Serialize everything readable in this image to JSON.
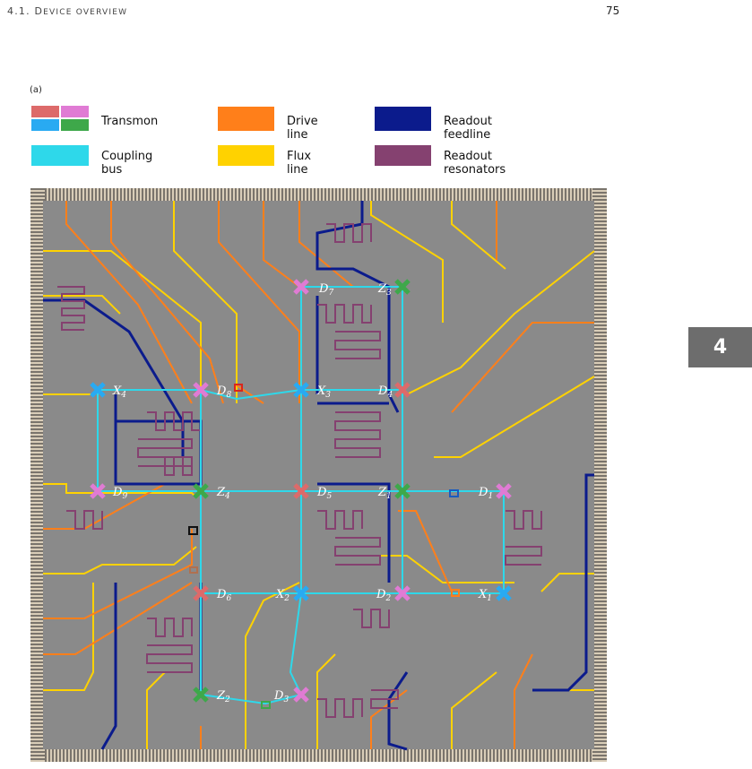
{
  "header": {
    "section_prefix": "4.1. ",
    "section_cap1": "D",
    "section_rest1": "EVICE ",
    "section_rest2": "OVERVIEW",
    "page_number": "75"
  },
  "figure": {
    "panel_label": "(a)"
  },
  "legend": {
    "transmon": "Transmon",
    "coupling_bus": "Coupling bus",
    "drive_line": "Drive line",
    "flux_line": "Flux line",
    "readout_feedline": "Readout feedline",
    "readout_resonators": "Readout resonators"
  },
  "colors": {
    "transmon_red": "#dd6a6a",
    "transmon_pink": "#e07bd4",
    "transmon_blue": "#29aaf2",
    "transmon_green": "#3ea84a",
    "coupling_bus": "#2ed8ea",
    "drive_line": "#ff7f1a",
    "flux_line": "#ffd200",
    "readout_feedline": "#0b1b8c",
    "readout_resonators": "#854170",
    "chip_bg": "#8a8a8a"
  },
  "qubits": {
    "D7": {
      "n": "D",
      "s": "7"
    },
    "Z3": {
      "n": "Z",
      "s": "3"
    },
    "X4": {
      "n": "X",
      "s": "4"
    },
    "D8": {
      "n": "D",
      "s": "8"
    },
    "X3": {
      "n": "X",
      "s": "3"
    },
    "D4": {
      "n": "D",
      "s": "4"
    },
    "D9": {
      "n": "D",
      "s": "9"
    },
    "Z4": {
      "n": "Z",
      "s": "4"
    },
    "D5": {
      "n": "D",
      "s": "5"
    },
    "Z1": {
      "n": "Z",
      "s": "1"
    },
    "D1": {
      "n": "D",
      "s": "1"
    },
    "D6": {
      "n": "D",
      "s": "6"
    },
    "X2": {
      "n": "X",
      "s": "2"
    },
    "D2": {
      "n": "D",
      "s": "2"
    },
    "X1": {
      "n": "X",
      "s": "1"
    },
    "Z2": {
      "n": "Z",
      "s": "2"
    },
    "D3": {
      "n": "D",
      "s": "3"
    }
  },
  "chapter_tab": "4"
}
